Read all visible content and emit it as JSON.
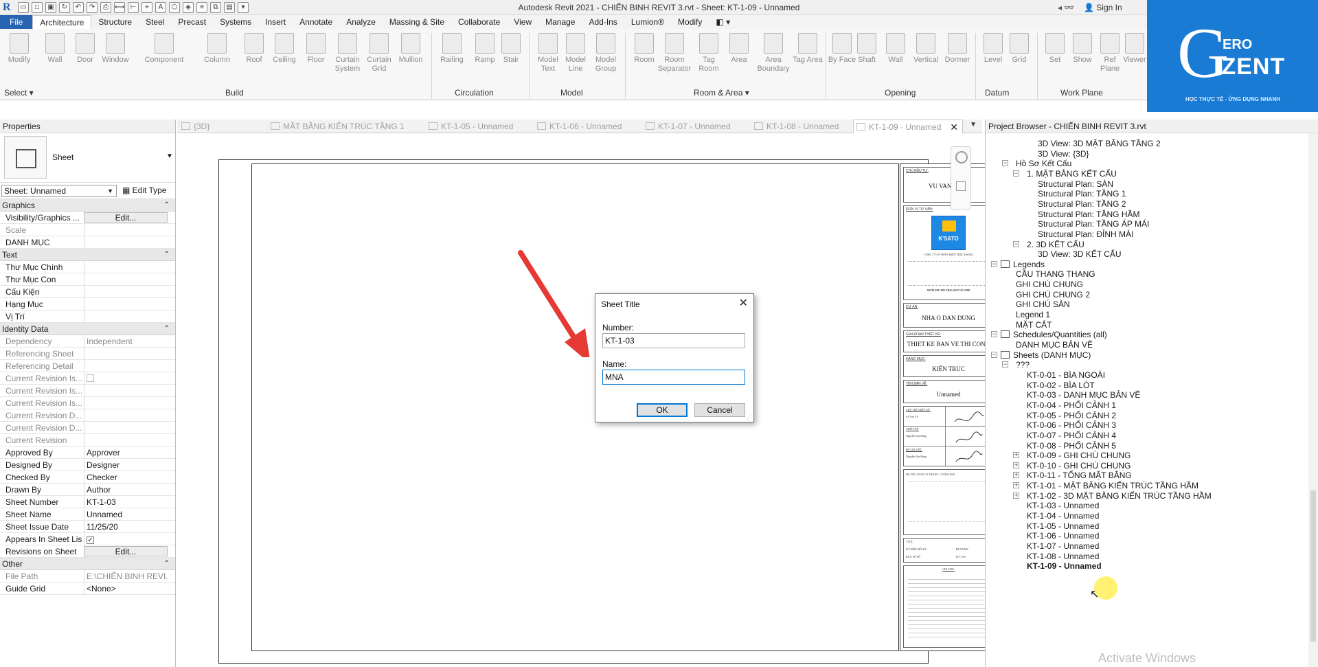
{
  "window": {
    "app_title": "Autodesk Revit 2021 - CHIẾN BINH REVIT 3.rvt - Sheet: KT-1-09 - Unnamed",
    "sign_in": "Sign In"
  },
  "ribbon_tabs": [
    "File",
    "Architecture",
    "Structure",
    "Steel",
    "Precast",
    "Systems",
    "Insert",
    "Annotate",
    "Analyze",
    "Massing & Site",
    "Collaborate",
    "View",
    "Manage",
    "Add-Ins",
    "Lumion®",
    "Modify"
  ],
  "ribbon": {
    "buttons": [
      {
        "label": "Modify"
      },
      {
        "label": "Wall"
      },
      {
        "label": "Door"
      },
      {
        "label": "Window"
      },
      {
        "label": "Component"
      },
      {
        "label": "Column"
      },
      {
        "label": "Roof"
      },
      {
        "label": "Ceiling"
      },
      {
        "label": "Floor"
      },
      {
        "label": "Curtain System"
      },
      {
        "label": "Curtain Grid"
      },
      {
        "label": "Mullion"
      },
      {
        "label": "Railing"
      },
      {
        "label": "Ramp"
      },
      {
        "label": "Stair"
      },
      {
        "label": "Model Text"
      },
      {
        "label": "Model Line"
      },
      {
        "label": "Model Group"
      },
      {
        "label": "Room"
      },
      {
        "label": "Room Separator"
      },
      {
        "label": "Tag Room"
      },
      {
        "label": "Area"
      },
      {
        "label": "Area Boundary"
      },
      {
        "label": "Tag Area"
      },
      {
        "label": "By Face"
      },
      {
        "label": "Shaft"
      },
      {
        "label": "Wall"
      },
      {
        "label": "Vertical"
      },
      {
        "label": "Dormer"
      },
      {
        "label": "Level"
      },
      {
        "label": "Grid"
      },
      {
        "label": "Set"
      },
      {
        "label": "Show"
      },
      {
        "label": "Ref Plane"
      },
      {
        "label": "Viewer"
      }
    ],
    "panels": [
      "Select ▾",
      "Build",
      "Circulation",
      "Model",
      "Room & Area ▾",
      "Opening",
      "Datum",
      "Work Plane"
    ]
  },
  "brand": {
    "ero": "ERO",
    "izent": "IZENT",
    "slogan": "HỌC THỰC TẾ - ỨNG DỤNG NHANH",
    "accent": "#1a7bd4"
  },
  "properties": {
    "header": "Properties",
    "type_name": "Sheet",
    "instance_selector": "Sheet: Unnamed",
    "edit_type": "Edit Type",
    "groups": [
      {
        "name": "Graphics",
        "rows": [
          {
            "name": "Visibility/Graphics ...",
            "value": "Edit...",
            "kind": "button"
          },
          {
            "name": "Scale",
            "value": "",
            "dim": true
          },
          {
            "name": "DANH MỤC",
            "value": ""
          }
        ]
      },
      {
        "name": "Text",
        "rows": [
          {
            "name": "Thư Mục Chính",
            "value": ""
          },
          {
            "name": "Thư Mục Con",
            "value": ""
          },
          {
            "name": "Cấu Kiện",
            "value": ""
          },
          {
            "name": "Hạng Mục",
            "value": ""
          },
          {
            "name": "Vị Trí",
            "value": ""
          }
        ]
      },
      {
        "name": "Identity Data",
        "rows": [
          {
            "name": "Dependency",
            "value": "Independent",
            "dim": true
          },
          {
            "name": "Referencing Sheet",
            "value": "",
            "dim": true
          },
          {
            "name": "Referencing Detail",
            "value": "",
            "dim": true
          },
          {
            "name": "Current Revision Is...",
            "value": "",
            "dim": true,
            "kind": "checkbox-off"
          },
          {
            "name": "Current Revision Is...",
            "value": "",
            "dim": true
          },
          {
            "name": "Current Revision Is...",
            "value": "",
            "dim": true
          },
          {
            "name": "Current Revision D...",
            "value": "",
            "dim": true
          },
          {
            "name": "Current Revision D...",
            "value": "",
            "dim": true
          },
          {
            "name": "Current Revision",
            "value": "",
            "dim": true
          },
          {
            "name": "Approved By",
            "value": "Approver"
          },
          {
            "name": "Designed By",
            "value": "Designer"
          },
          {
            "name": "Checked By",
            "value": "Checker"
          },
          {
            "name": "Drawn By",
            "value": "Author"
          },
          {
            "name": "Sheet Number",
            "value": "KT-1-03"
          },
          {
            "name": "Sheet Name",
            "value": "Unnamed"
          },
          {
            "name": "Sheet Issue Date",
            "value": "11/25/20"
          },
          {
            "name": "Appears In Sheet List",
            "value": "",
            "kind": "checkbox-on"
          },
          {
            "name": "Revisions on Sheet",
            "value": "Edit...",
            "kind": "button"
          }
        ]
      },
      {
        "name": "Other",
        "rows": [
          {
            "name": "File Path",
            "value": "E:\\CHIẾN BINH REVI...",
            "dim": true
          },
          {
            "name": "Guide Grid",
            "value": "<None>"
          }
        ]
      }
    ]
  },
  "view_tabs": [
    {
      "label": "{3D}"
    },
    {
      "label": "MẶT BẰNG KIẾN TRÚC TẦNG 1"
    },
    {
      "label": "KT-1-05 - Unnamed"
    },
    {
      "label": "KT-1-06 - Unnamed"
    },
    {
      "label": "KT-1-07 - Unnamed"
    },
    {
      "label": "KT-1-08 - Unnamed"
    },
    {
      "label": "KT-1-09 - Unnamed",
      "active": true
    }
  ],
  "titleblock": {
    "chu_dau_tu_label": "CHỦ ĐẦU TƯ:",
    "chu_dau_tu": "VU VAN VINH",
    "don_vi_label": "ĐƠN VỊ TƯ VẤN:",
    "company_logo": "K'SATO",
    "company": "CÔNG TY CỔ PHẦN KIẾN TRÚC KSATO",
    "hotline": "HOTLINE HỖ TRỢ: 0347.167.4789",
    "du_an_label": "DỰ ÁN:",
    "du_an": "NHA O DAN DUNG",
    "giai_doan_label": "GIAI ĐOẠN THIẾT KẾ:",
    "giai_doan": "THIET KE BAN VE THI CONG",
    "hang_muc_label": "HẠNG MỤC:",
    "hang_muc": "KIẾN TRUC",
    "ten_ban_ve_label": "TÊN BẢN VẼ:",
    "ten_ban_ve": "Unnamed",
    "chu_tri_label": "CHỦ TRÌ THIẾT KẾ:",
    "chu_tri": "Lê Văn Vũ",
    "thiet_ke_label": "THIẾT KẾ:",
    "thiet_ke": "Nguyễn Văn Hùng",
    "bo_chi_label": "BỐ CHI TIẾT:",
    "bo_chi": "Nguyễn Văn Hùng",
    "date_line": "HÀ NỘI, NGÀY 25 THÁNG 11 NĂM 2020",
    "ti_le_label": "TỈ LỆ",
    "ky_hieu_label": "KÝ HIỆU HỒ SƠ",
    "ky_hieu": "BT-NVHN",
    "ban_ve_so_label": "BẢN VẼ SỐ",
    "ban_ve_so": "KT-1-09",
    "ghi_chu_label": "GHI CHÚ:"
  },
  "dialog": {
    "title": "Sheet Title",
    "number_label": "Number:",
    "number_value": "KT-1-03",
    "name_label": "Name:",
    "name_value": "MNA",
    "ok": "OK",
    "cancel": "Cancel"
  },
  "project_browser": {
    "header": "Project Browser - CHIẾN BINH REVIT 3.rvt",
    "items": [
      {
        "label": "3D View: 3D MẶT BẰNG TẦNG 2",
        "depth": 4
      },
      {
        "label": "3D View: {3D}",
        "depth": 4
      },
      {
        "label": "Hồ Sơ Kết Cấu",
        "depth": 2,
        "exp": "−"
      },
      {
        "label": "1. MẶT BẰNG KẾT CẤU",
        "depth": 3,
        "exp": "−"
      },
      {
        "label": "Structural Plan: SÀN",
        "depth": 4
      },
      {
        "label": "Structural Plan: TẦNG 1",
        "depth": 4
      },
      {
        "label": "Structural Plan: TẦNG 2",
        "depth": 4
      },
      {
        "label": "Structural Plan: TẦNG HẦM",
        "depth": 4
      },
      {
        "label": "Structural Plan: TẦNG ÁP MÁI",
        "depth": 4
      },
      {
        "label": "Structural Plan: ĐỈNH MÁI",
        "depth": 4
      },
      {
        "label": "2. 3D KẾT CẤU",
        "depth": 3,
        "exp": "−"
      },
      {
        "label": "3D View: 3D KẾT CẤU",
        "depth": 4
      },
      {
        "label": "Legends",
        "depth": 1,
        "exp": "−",
        "icon": true
      },
      {
        "label": "CẦU THANG THANG",
        "depth": 2
      },
      {
        "label": "GHI CHÚ CHUNG",
        "depth": 2
      },
      {
        "label": "GHI CHÚ CHUNG 2",
        "depth": 2
      },
      {
        "label": "GHI CHÚ SÀN",
        "depth": 2
      },
      {
        "label": "Legend 1",
        "depth": 2
      },
      {
        "label": "MẶT CẮT",
        "depth": 2
      },
      {
        "label": "Schedules/Quantities (all)",
        "depth": 1,
        "exp": "−",
        "icon": true
      },
      {
        "label": "DANH MỤC BẢN VẼ",
        "depth": 2
      },
      {
        "label": "Sheets (DANH MỤC)",
        "depth": 1,
        "exp": "−",
        "icon": true
      },
      {
        "label": "???",
        "depth": 2,
        "exp": "−"
      },
      {
        "label": "KT-0-01 - BÌA NGOÀI",
        "depth": 3
      },
      {
        "label": "KT-0-02 - BÌA LÓT",
        "depth": 3
      },
      {
        "label": "KT-0-03 - DANH MỤC BẢN VẼ",
        "depth": 3
      },
      {
        "label": "KT-0-04 - PHỐI CẢNH 1",
        "depth": 3
      },
      {
        "label": "KT-0-05 - PHỐI CẢNH 2",
        "depth": 3
      },
      {
        "label": "KT-0-06 - PHỐI CẢNH 3",
        "depth": 3
      },
      {
        "label": "KT-0-07 - PHỐI CẢNH 4",
        "depth": 3
      },
      {
        "label": "KT-0-08 - PHỐI CẢNH 5",
        "depth": 3
      },
      {
        "label": "KT-0-09 - GHI CHÚ CHUNG",
        "depth": 3,
        "exp": "+"
      },
      {
        "label": "KT-0-10 - GHI CHÚ CHUNG",
        "depth": 3,
        "exp": "+"
      },
      {
        "label": "KT-0-11 - TỔNG MẶT BẰNG",
        "depth": 3,
        "exp": "+"
      },
      {
        "label": "KT-1-01 - MẶT BẰNG KIẾN TRÚC TẦNG HẦM",
        "depth": 3,
        "exp": "+"
      },
      {
        "label": "KT-1-02 - 3D MẶT BẰNG KIẾN TRÚC TẦNG HẦM",
        "depth": 3,
        "exp": "+"
      },
      {
        "label": "KT-1-03 - Unnamed",
        "depth": 3
      },
      {
        "label": "KT-1-04 - Unnamed",
        "depth": 3
      },
      {
        "label": "KT-1-05 - Unnamed",
        "depth": 3
      },
      {
        "label": "KT-1-06 - Unnamed",
        "depth": 3
      },
      {
        "label": "KT-1-07 - Unnamed",
        "depth": 3
      },
      {
        "label": "KT-1-08 - Unnamed",
        "depth": 3
      },
      {
        "label": "KT-1-09 - Unnamed",
        "depth": 3,
        "selected": true
      }
    ]
  },
  "watermark": "Activate Windows",
  "colors": {
    "file_tab": "#2765b3",
    "arrow": "#e53935",
    "dialog_focus": "#0078d7",
    "highlight": "#ffe800"
  }
}
